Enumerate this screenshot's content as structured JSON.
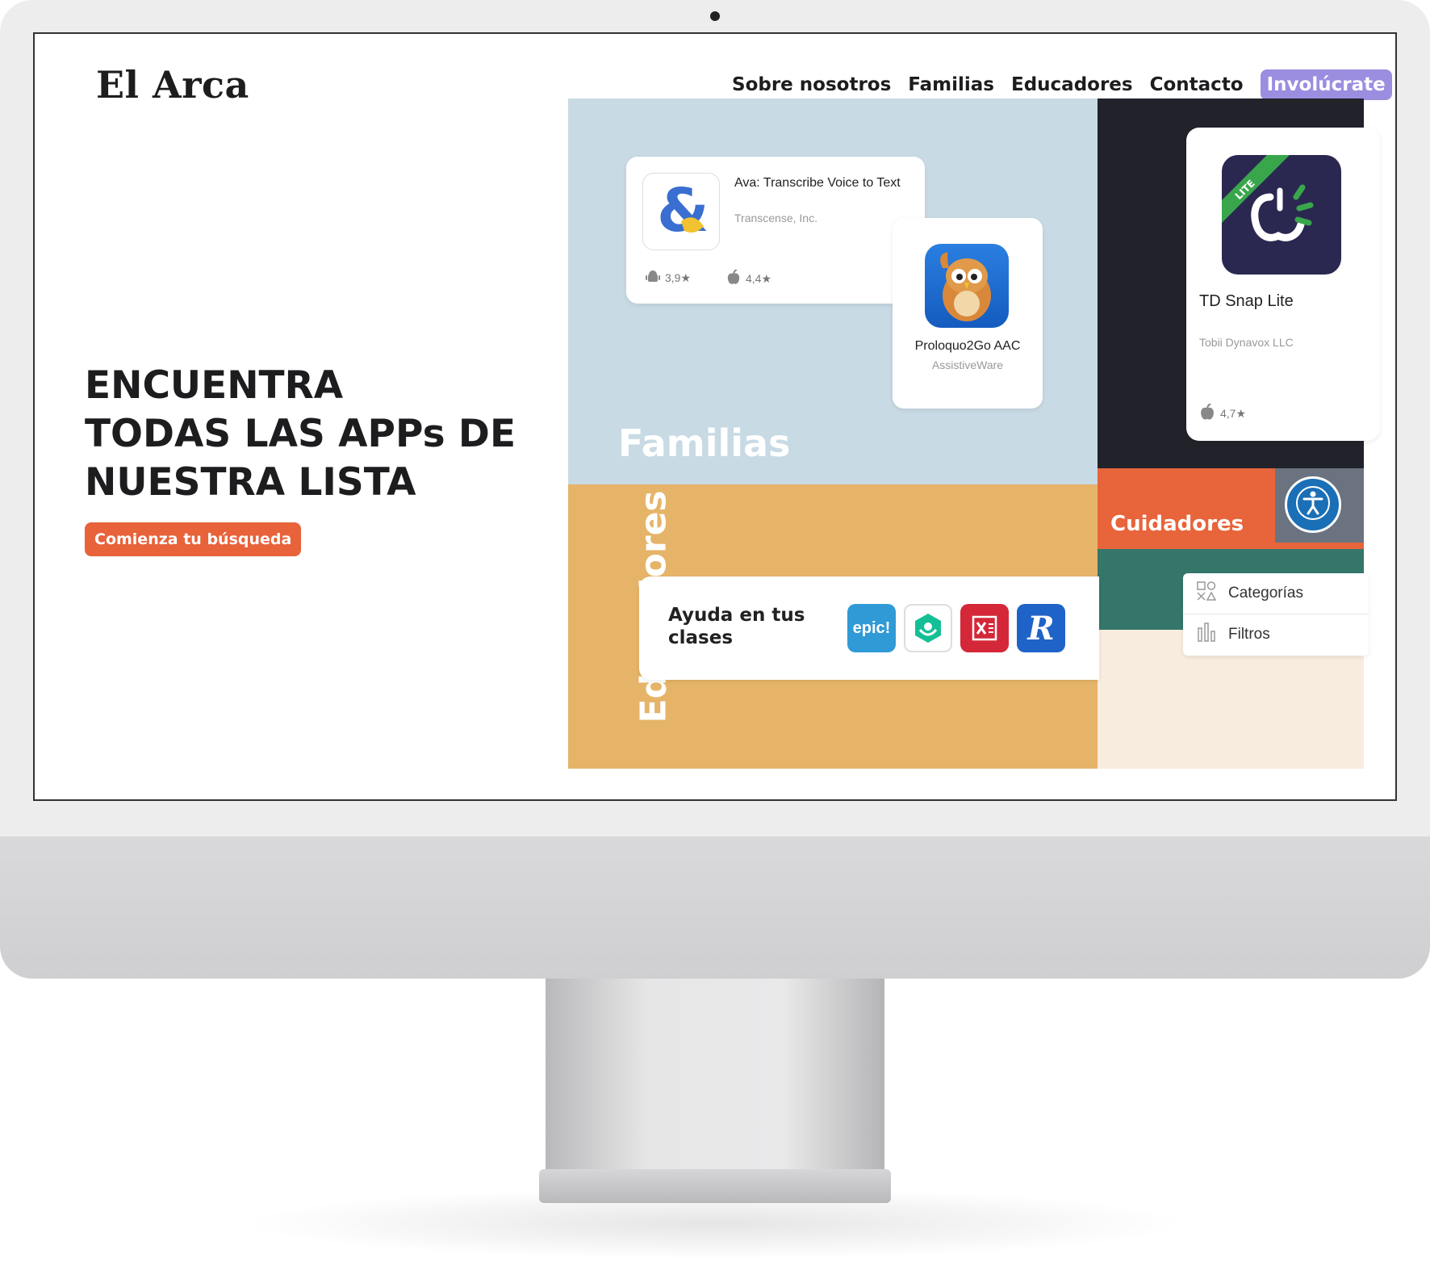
{
  "brand": {
    "name": "El Arca"
  },
  "nav": {
    "items": [
      "Sobre nosotros",
      "Familias",
      "Educadores",
      "Contacto"
    ],
    "cta": "Involúcrate"
  },
  "hero": {
    "title_lines": [
      "ENCUENTRA",
      "TODAS LAS APPs DE",
      "NUESTRA LISTA"
    ],
    "button": "Comienza tu búsqueda"
  },
  "familias": {
    "label": "Familias",
    "ava": {
      "title": "Ava: Transcribe Voice to Text",
      "developer": "Transcense, Inc.",
      "android_rating": "3,9★",
      "ios_rating": "4,4★"
    },
    "proloquo": {
      "title": "Proloquo2Go AAC",
      "developer": "AssistiveWare"
    }
  },
  "td_snap": {
    "title": "TD Snap Lite",
    "developer": "Tobii Dynavox LLC",
    "ios_rating": "4,7★",
    "badge": "LITE"
  },
  "cuidadores": {
    "label": "Cuidadores"
  },
  "menu": {
    "categorias": "Categorías",
    "filtros": "Filtros"
  },
  "educadores": {
    "label": "Educadores",
    "card_text": "Ayuda en tus clases",
    "apps": [
      "epic!",
      "Khan Academy Kids",
      "Excel",
      "Raz-Kids"
    ]
  },
  "colors": {
    "accent_orange": "#e8623a",
    "accent_purple": "#9b8ee0",
    "familias_bg": "#c8dae4",
    "educadores_bg": "#e6b468",
    "cuidadores_bg": "#e8643a",
    "dark_bg": "#22222b",
    "teal_bg": "#35766b"
  }
}
